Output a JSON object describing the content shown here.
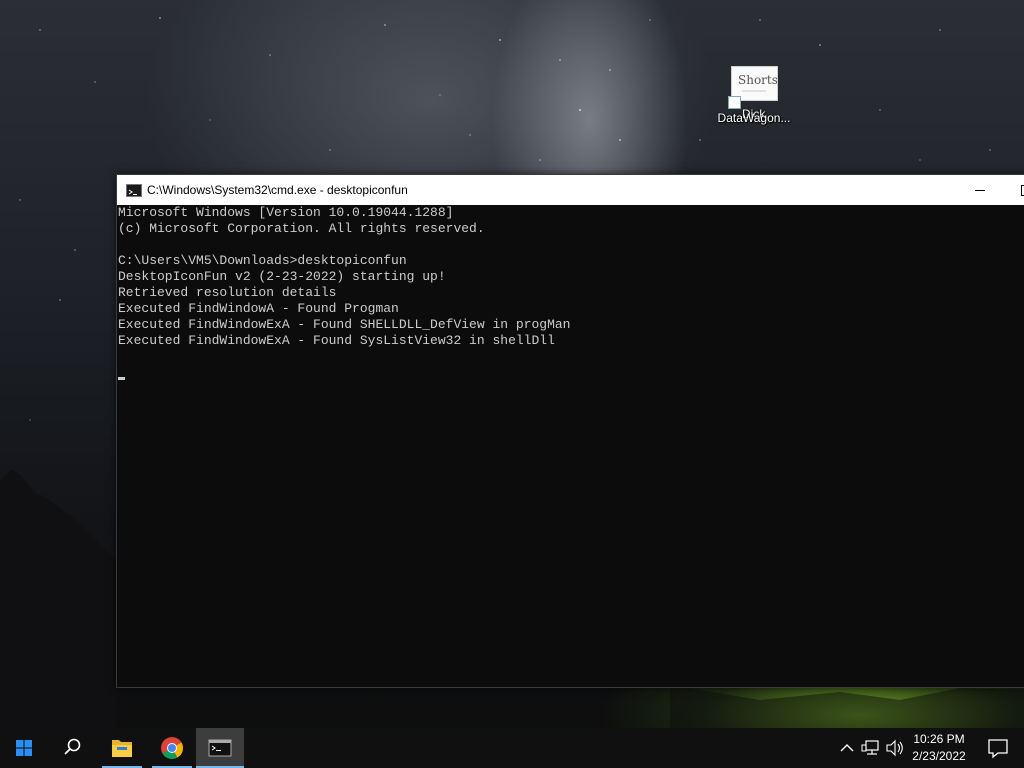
{
  "desktop": {
    "icon": {
      "label": "DataWagon...",
      "thumbnail_text": "Shorts",
      "overlap_label": "Dick"
    }
  },
  "window": {
    "title": "C:\\Windows\\System32\\cmd.exe - desktopiconfun",
    "console_lines": [
      "Microsoft Windows [Version 10.0.19044.1288]",
      "(c) Microsoft Corporation. All rights reserved.",
      "",
      "C:\\Users\\VM5\\Downloads>desktopiconfun",
      "DesktopIconFun v2 (2-23-2022) starting up!",
      "Retrieved resolution details",
      "Executed FindWindowA - Found Progman",
      "Executed FindWindowExA - Found SHELLDLL_DefView in progMan",
      "Executed FindWindowExA - Found SysListView32 in shellDll"
    ]
  },
  "taskbar": {
    "apps": [
      {
        "name": "start",
        "icon": "windows-logo-icon"
      },
      {
        "name": "search",
        "icon": "search-icon"
      },
      {
        "name": "file-explorer",
        "icon": "folder-icon"
      },
      {
        "name": "chrome",
        "icon": "chrome-icon"
      },
      {
        "name": "cmd",
        "icon": "terminal-icon",
        "active": true
      }
    ],
    "tray": {
      "icons": [
        "chevron-up-icon",
        "network-icon",
        "volume-icon"
      ],
      "time": "10:26 PM",
      "date": "2/23/2022"
    }
  },
  "colors": {
    "taskbar_bg": "#101010",
    "console_bg": "#0c0c0c",
    "console_fg": "#cccccc",
    "accent": "#76b9ed",
    "start_blue": "#2b8ef0"
  }
}
